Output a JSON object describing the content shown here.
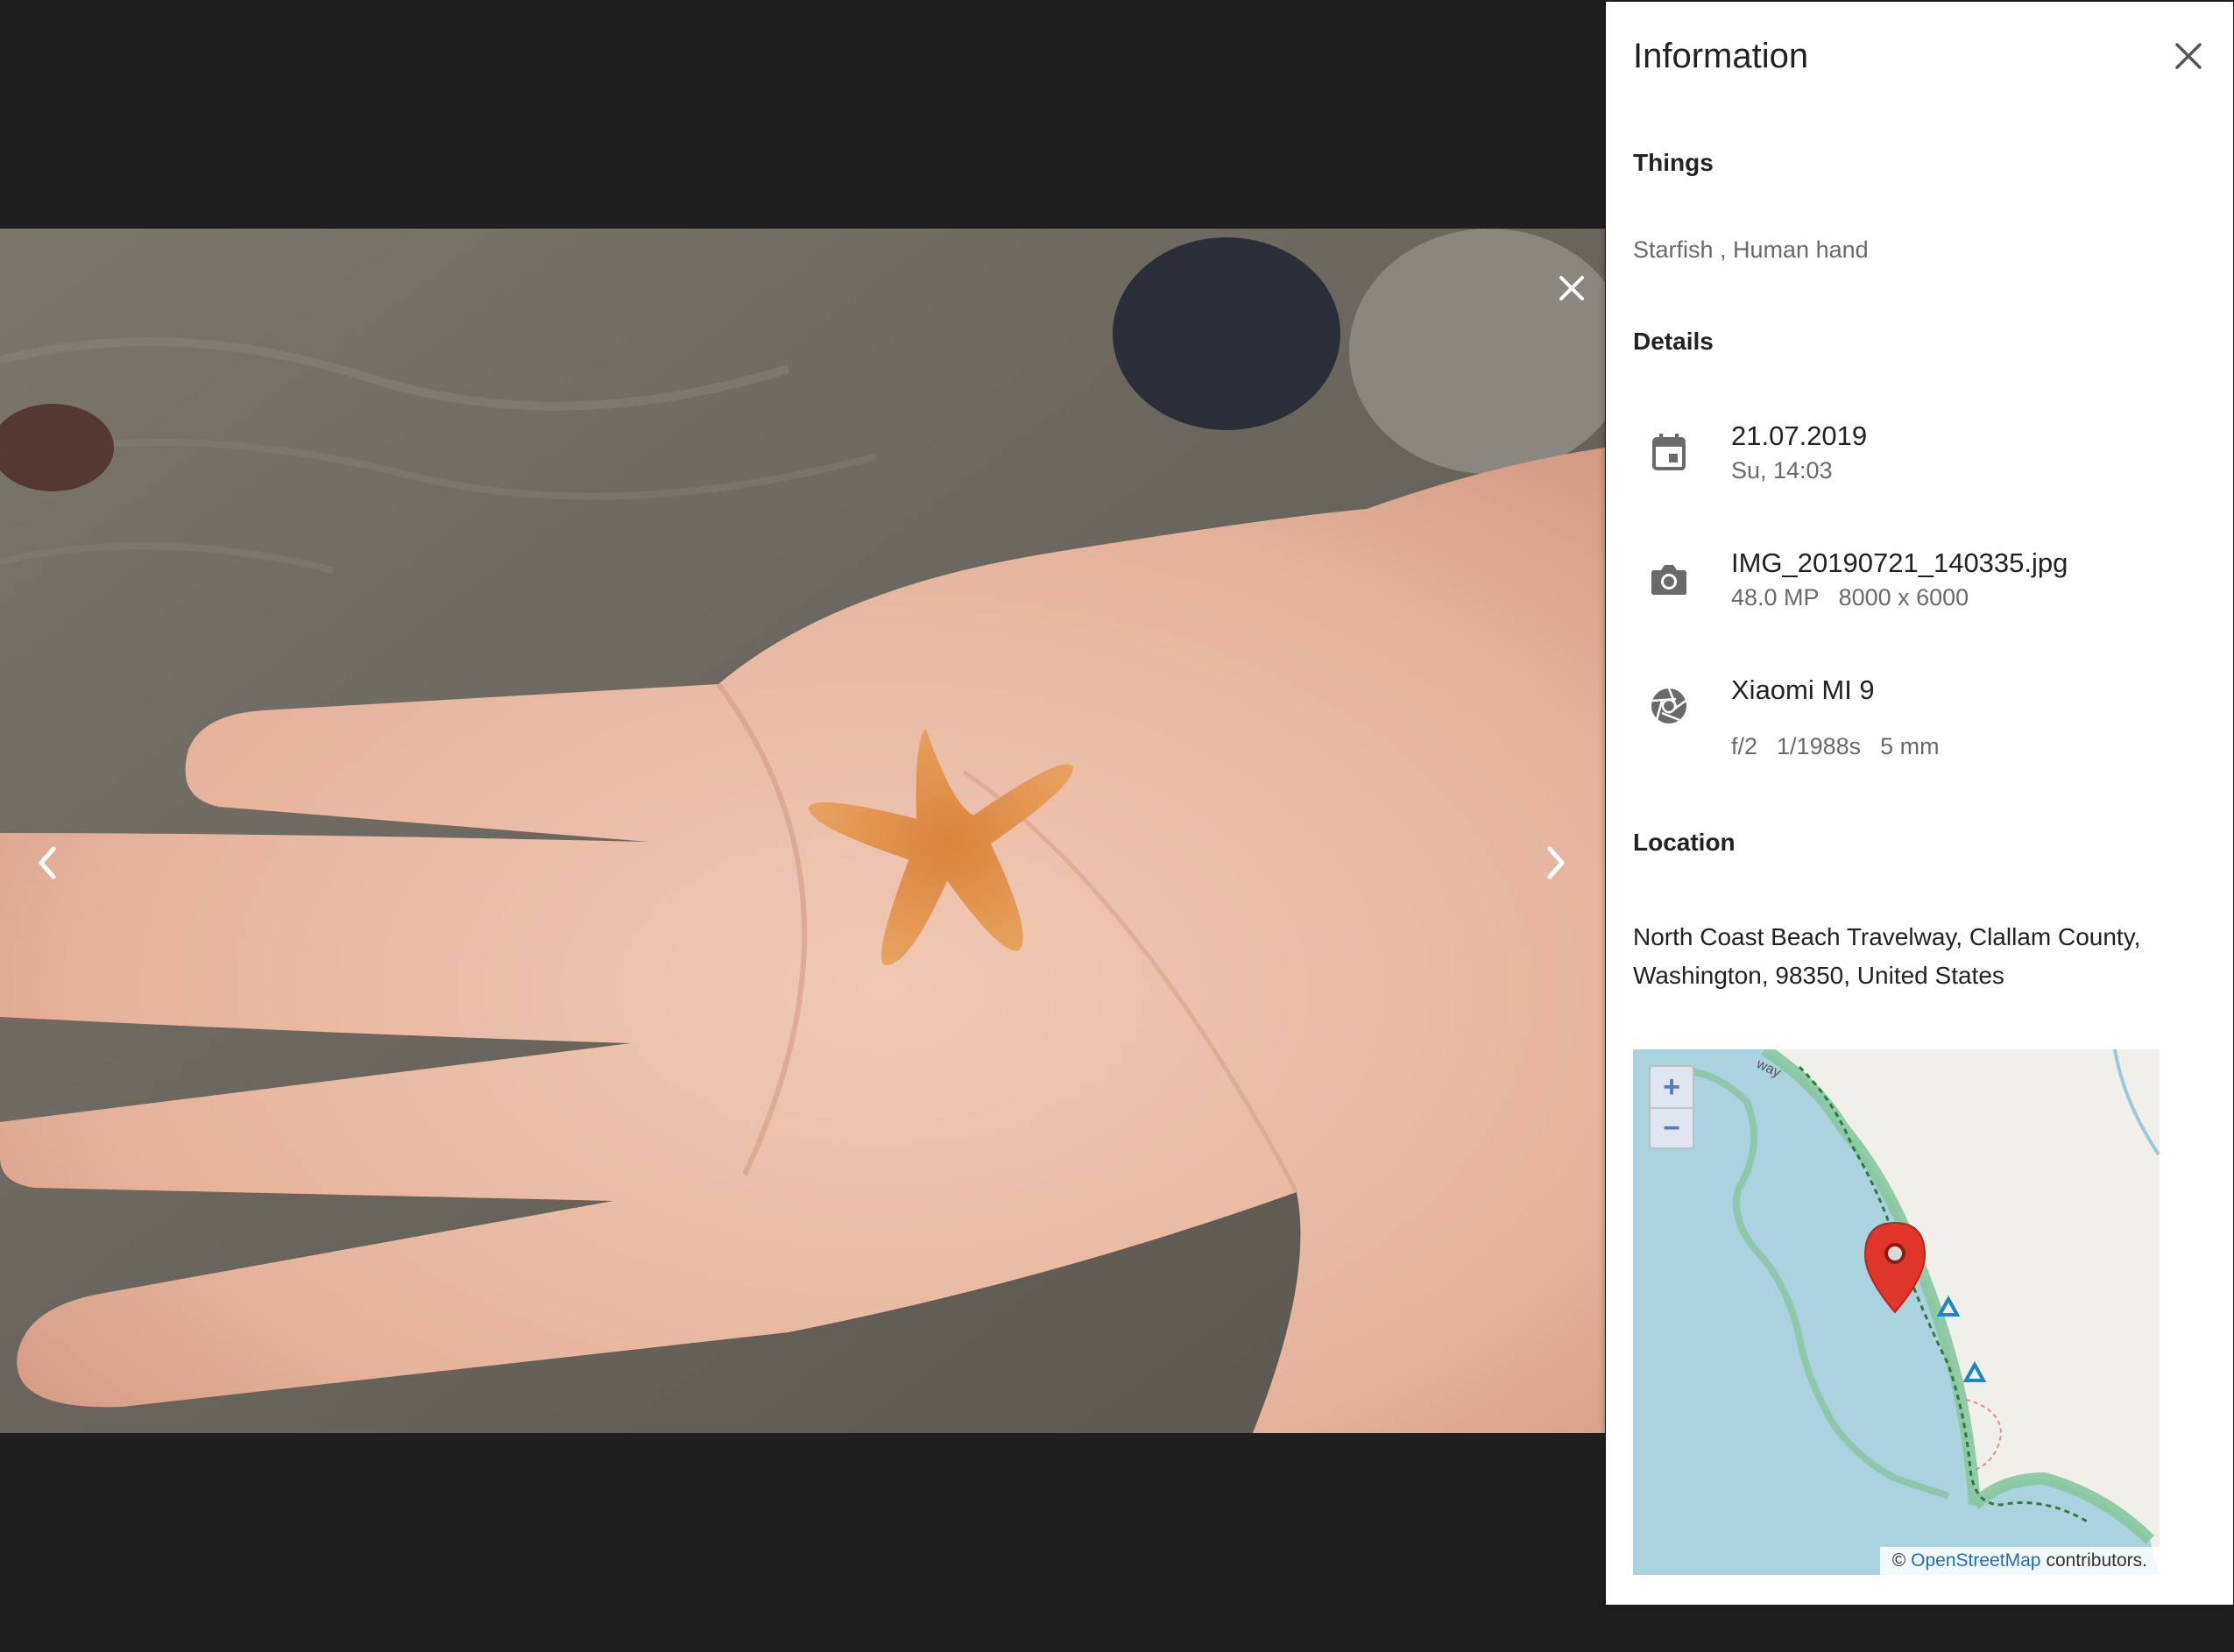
{
  "viewer": {
    "close_icon": "close-icon",
    "prev_icon": "chevron-left-icon",
    "next_icon": "chevron-right-icon"
  },
  "panel": {
    "title": "Information",
    "close_icon": "close-icon",
    "things": {
      "heading": "Things",
      "value": "Starfish , Human hand"
    },
    "details": {
      "heading": "Details",
      "date": {
        "icon": "calendar-icon",
        "main": "21.07.2019",
        "sub": "Su, 14:03"
      },
      "file": {
        "icon": "camera-icon",
        "main": "IMG_20190721_140335.jpg",
        "megapixels": "48.0 MP",
        "resolution": "8000 x 6000"
      },
      "camera": {
        "icon": "aperture-icon",
        "main": "Xiaomi MI 9",
        "aperture": "f/2",
        "exposure": "1/1988s",
        "focal": "5 mm"
      }
    },
    "location": {
      "heading": "Location",
      "address_line1": "North Coast Beach Travelway, Clallam County,",
      "address_line2": "Washington, 98350, United States",
      "map": {
        "zoom_in": "+",
        "zoom_out": "−",
        "attribution_prefix": "©",
        "attribution_link": "OpenStreetMap",
        "attribution_suffix": "contributors.",
        "road_label": "way",
        "marker_color": "#e0352b",
        "water_color": "#aad3df",
        "land_color": "#f1efe9"
      }
    }
  }
}
